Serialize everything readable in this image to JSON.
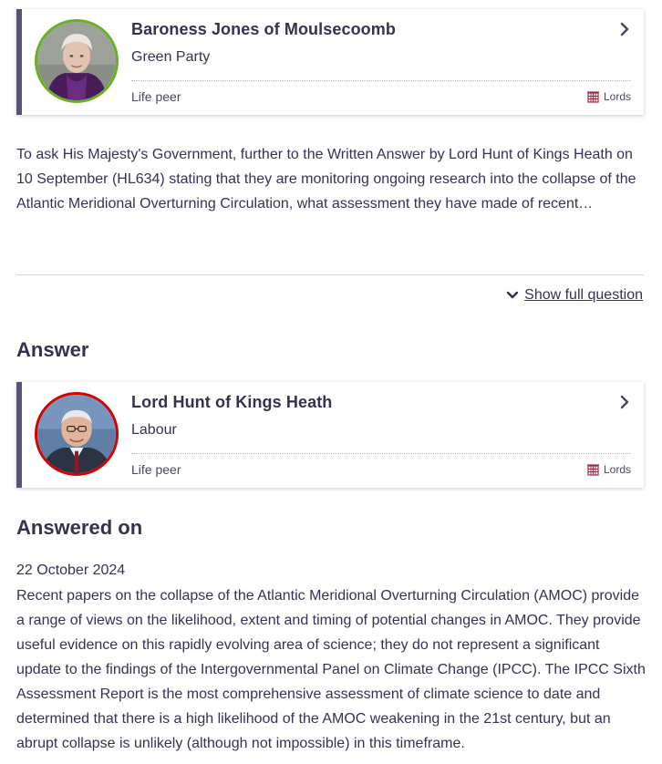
{
  "asker": {
    "name": "Baroness Jones of Moulsecoomb",
    "party": "Green Party",
    "member_type": "Life peer",
    "house": "Lords",
    "party_color": "#6ab023"
  },
  "question": {
    "text": "To ask His Majesty's Government, further to the Written Answer by Lord Hunt of Kings Heath on 10 September (HL634) stating that they are monitoring ongoing research into the collapse of the Atlantic Meridional Overturning Circulation, what assessment they have made of recent…",
    "show_full_label": "Show full question"
  },
  "answer_section": {
    "heading": "Answer"
  },
  "answerer": {
    "name": "Lord Hunt of Kings Heath",
    "party": "Labour",
    "member_type": "Life peer",
    "house": "Lords",
    "party_color": "#d50000"
  },
  "answered_on": {
    "heading": "Answered on",
    "date": "22 October 2024",
    "text": "Recent papers on the collapse of the Atlantic Meridional Overturning Circulation (AMOC) provide a range of views on the likelihood, extent and timing of potential changes in AMOC. They provide useful evidence on this rapidly evolving area of science; they do not represent a significant update to the findings of the Intergovernmental Panel on Climate Change (IPCC). The IPCC Sixth Assessment Report is the most comprehensive assessment of climate science to date and determined that there is a high likelihood of the AMOC weakening in the 21st century, but an abrupt collapse is unlikely (although not impossible) in this timeframe."
  },
  "colors": {
    "text": "#373151",
    "card_accent": "#585276",
    "lords_red": "#9e2b42"
  }
}
